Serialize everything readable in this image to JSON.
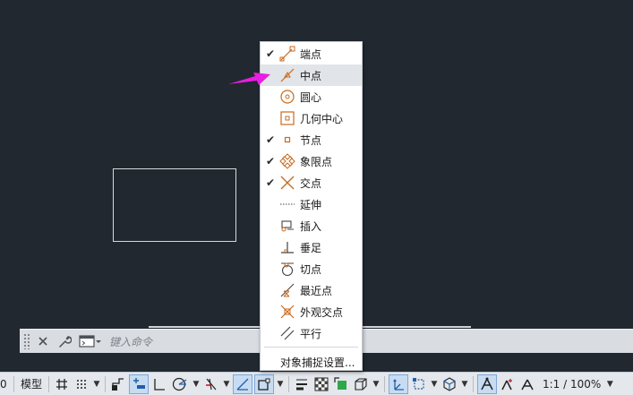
{
  "command_line": {
    "prompt_placeholder": "键入命令"
  },
  "osnap_menu": {
    "items": [
      {
        "label": "端点",
        "checked": "✔",
        "icon": "endpoint-icon"
      },
      {
        "label": "中点",
        "checked": "",
        "icon": "midpoint-icon",
        "highlighted": true
      },
      {
        "label": "圆心",
        "checked": "",
        "icon": "center-icon"
      },
      {
        "label": "几何中心",
        "checked": "",
        "icon": "geometric-center-icon"
      },
      {
        "label": "节点",
        "checked": "✔",
        "icon": "node-icon"
      },
      {
        "label": "象限点",
        "checked": "✔",
        "icon": "quadrant-icon"
      },
      {
        "label": "交点",
        "checked": "✔",
        "icon": "intersection-icon"
      },
      {
        "label": "延伸",
        "checked": "",
        "icon": "extension-icon"
      },
      {
        "label": "插入",
        "checked": "",
        "icon": "insert-icon"
      },
      {
        "label": "垂足",
        "checked": "",
        "icon": "perpendicular-icon"
      },
      {
        "label": "切点",
        "checked": "",
        "icon": "tangent-icon"
      },
      {
        "label": "最近点",
        "checked": "",
        "icon": "nearest-icon"
      },
      {
        "label": "外观交点",
        "checked": "",
        "icon": "apparent-intersection-icon"
      },
      {
        "label": "平行",
        "checked": "",
        "icon": "parallel-icon"
      }
    ],
    "settings_label": "对象捕捉设置..."
  },
  "status_bar": {
    "left_clip_text": "0",
    "model_label": "模型",
    "scale_label": "1:1 / 100%"
  },
  "colors": {
    "canvas_bg": "#212830",
    "osnap_marker": "#c86a1e",
    "pointer_arrow": "#e81ee0"
  }
}
